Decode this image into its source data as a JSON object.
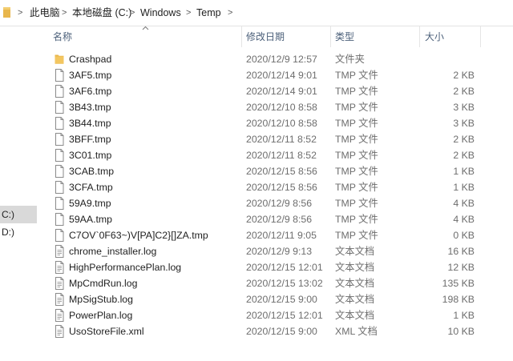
{
  "breadcrumb": [
    "此电脑",
    "本地磁盘 (C:)",
    "Windows",
    "Temp"
  ],
  "breadcrumb_separator": ">",
  "nav": [
    {
      "label": "C:)",
      "selected": true
    },
    {
      "label": "D:)",
      "selected": false
    }
  ],
  "columns": {
    "name": "名称",
    "date": "修改日期",
    "type": "类型",
    "size": "大小"
  },
  "colors": {
    "folder": "#e8b64c",
    "header_text": "#4c607a",
    "selected_bg": "#d9d9d9"
  },
  "files": [
    {
      "name": "Crashpad",
      "date": "2020/12/9 12:57",
      "type": "文件夹",
      "size": "",
      "icon": "folder-icon"
    },
    {
      "name": "3AF5.tmp",
      "date": "2020/12/14 9:01",
      "type": "TMP 文件",
      "size": "2 KB",
      "icon": "file-icon"
    },
    {
      "name": "3AF6.tmp",
      "date": "2020/12/14 9:01",
      "type": "TMP 文件",
      "size": "2 KB",
      "icon": "file-icon"
    },
    {
      "name": "3B43.tmp",
      "date": "2020/12/10 8:58",
      "type": "TMP 文件",
      "size": "3 KB",
      "icon": "file-icon"
    },
    {
      "name": "3B44.tmp",
      "date": "2020/12/10 8:58",
      "type": "TMP 文件",
      "size": "3 KB",
      "icon": "file-icon"
    },
    {
      "name": "3BFF.tmp",
      "date": "2020/12/11 8:52",
      "type": "TMP 文件",
      "size": "2 KB",
      "icon": "file-icon"
    },
    {
      "name": "3C01.tmp",
      "date": "2020/12/11 8:52",
      "type": "TMP 文件",
      "size": "2 KB",
      "icon": "file-icon"
    },
    {
      "name": "3CAB.tmp",
      "date": "2020/12/15 8:56",
      "type": "TMP 文件",
      "size": "1 KB",
      "icon": "file-icon"
    },
    {
      "name": "3CFA.tmp",
      "date": "2020/12/15 8:56",
      "type": "TMP 文件",
      "size": "1 KB",
      "icon": "file-icon"
    },
    {
      "name": "59A9.tmp",
      "date": "2020/12/9 8:56",
      "type": "TMP 文件",
      "size": "4 KB",
      "icon": "file-icon"
    },
    {
      "name": "59AA.tmp",
      "date": "2020/12/9 8:56",
      "type": "TMP 文件",
      "size": "4 KB",
      "icon": "file-icon"
    },
    {
      "name": "C7OV`0F63~)V[PA]C2}[]ZA.tmp",
      "date": "2020/12/11 9:05",
      "type": "TMP 文件",
      "size": "0 KB",
      "icon": "file-icon"
    },
    {
      "name": "chrome_installer.log",
      "date": "2020/12/9 9:13",
      "type": "文本文档",
      "size": "16 KB",
      "icon": "text-file-icon"
    },
    {
      "name": "HighPerformancePlan.log",
      "date": "2020/12/15 12:01",
      "type": "文本文档",
      "size": "12 KB",
      "icon": "text-file-icon"
    },
    {
      "name": "MpCmdRun.log",
      "date": "2020/12/15 13:02",
      "type": "文本文档",
      "size": "135 KB",
      "icon": "text-file-icon"
    },
    {
      "name": "MpSigStub.log",
      "date": "2020/12/15 9:00",
      "type": "文本文档",
      "size": "198 KB",
      "icon": "text-file-icon"
    },
    {
      "name": "PowerPlan.log",
      "date": "2020/12/15 12:01",
      "type": "文本文档",
      "size": "1 KB",
      "icon": "text-file-icon"
    },
    {
      "name": "UsoStoreFile.xml",
      "date": "2020/12/15 9:00",
      "type": "XML 文档",
      "size": "10 KB",
      "icon": "text-file-icon"
    }
  ]
}
